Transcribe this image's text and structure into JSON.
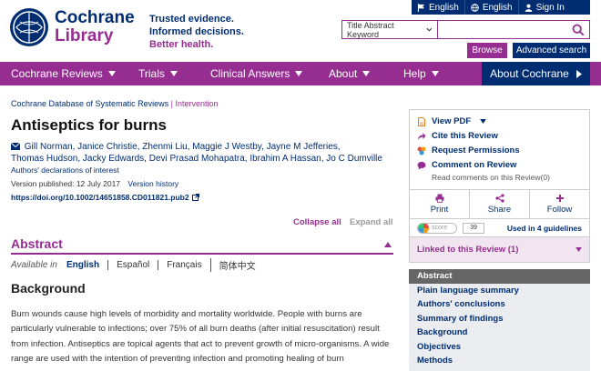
{
  "topbar": {
    "lang1": "English",
    "lang2": "English",
    "signin": "Sign In"
  },
  "brand": {
    "name1": "Cochrane",
    "name2": "Library",
    "tagline1": "Trusted evidence.",
    "tagline2": "Informed decisions.",
    "tagline3": "Better health."
  },
  "search": {
    "scope": "Title Abstract Keyword",
    "placeholder": "",
    "browse": "Browse",
    "advanced": "Advanced search"
  },
  "nav": {
    "items": [
      "Cochrane Reviews",
      "Trials",
      "Clinical Answers",
      "About",
      "Help"
    ],
    "about_cochrane": "About Cochrane"
  },
  "article": {
    "breadcrumb_db": "Cochrane Database of Systematic Reviews",
    "breadcrumb_sep": "|",
    "breadcrumb_type": "Intervention",
    "title": "Antiseptics for burns",
    "authors_line1": "Gill Norman, Janice Christie, Zhenmi Liu, Maggie J Westby, Jayne M Jefferies,",
    "authors_line2": "Thomas Hudson, Jacky Edwards, Devi Prasad Mohapatra, Ibrahim A Hassan, Jo C Dumville",
    "declarations": "Authors' declarations of interest",
    "version": "Version published: 12 July 2017",
    "version_history": "Version history",
    "doi": "https://doi.org/10.1002/14651858.CD011821.pub2",
    "collapse_all": "Collapse all",
    "expand_all": "Expand all",
    "abstract_heading": "Abstract",
    "available_in": "Available in",
    "languages": [
      "English",
      "Español",
      "Français",
      "简体中文"
    ],
    "background_heading": "Background",
    "background_text": "Burn wounds cause high levels of morbidity and mortality worldwide. People with burns are particularly vulnerable to infections; over 75% of all burn deaths (after initial resuscitation) result from infection. Antiseptics are topical agents that act to prevent growth of micro-organisms. A wide range are used with the intention of preventing infection and promoting healing of burn"
  },
  "sidebar": {
    "view_pdf": "View PDF",
    "cite": "Cite this Review",
    "permissions": "Request Permissions",
    "comment": "Comment on Review",
    "read_comments": "Read comments on this Review(0)",
    "print": "Print",
    "share": "Share",
    "follow": "Follow",
    "altmetric_label": "score",
    "altmetric_score": "39",
    "guidelines": "Used in 4 guidelines",
    "linked": "Linked to this Review (1)",
    "toc": [
      "Abstract",
      "Plain language summary",
      "Authors' conclusions",
      "Summary of findings",
      "Background",
      "Objectives",
      "Methods"
    ]
  },
  "colors": {
    "navy": "#002d72",
    "purple": "#962d91"
  }
}
